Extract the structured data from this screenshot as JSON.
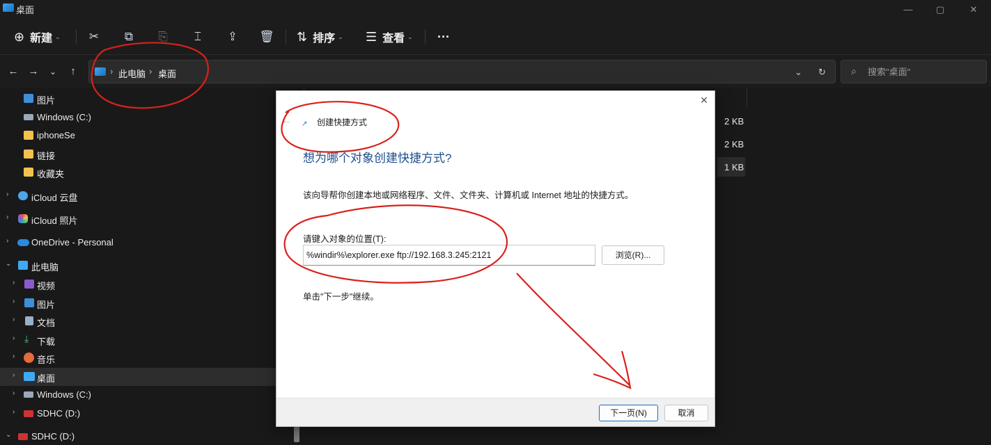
{
  "window": {
    "title": "桌面",
    "controls": {
      "minimize": "—",
      "maximize": "▢",
      "close": "✕"
    }
  },
  "toolbar": {
    "new_label": "新建",
    "sort_label": "排序",
    "view_label": "查看",
    "more_label": "···",
    "icons": [
      "cut-icon",
      "copy-icon",
      "paste-icon",
      "rename-icon",
      "share-icon",
      "delete-icon"
    ]
  },
  "nav": {
    "back": "←",
    "forward": "→",
    "recent": "⌄",
    "up": "↑"
  },
  "address": {
    "crumbs": [
      "此电脑",
      "桌面"
    ],
    "separator": "›",
    "dropdown": "⌄",
    "refresh": "↻"
  },
  "search": {
    "placeholder": "搜索\"桌面\""
  },
  "sidebar": {
    "items": [
      {
        "label": "图片",
        "icon": "pictures-icon",
        "color": "#3f8fd8"
      },
      {
        "label": "Windows (C:)",
        "icon": "drive-icon",
        "color": "#9aa9b8"
      },
      {
        "label": "iphoneSe",
        "icon": "folder-icon",
        "color": "#f2c24f"
      },
      {
        "label": "链接",
        "icon": "folder-icon",
        "color": "#f2c24f"
      },
      {
        "label": "收藏夹",
        "icon": "folder-icon",
        "color": "#f2c24f"
      },
      {
        "label": "iCloud 云盘",
        "icon": "icloud-drive-icon",
        "color": "#4ea6ea"
      },
      {
        "label": "iCloud 照片",
        "icon": "icloud-photos-icon",
        "color": "#e77"
      },
      {
        "label": "OneDrive - Personal",
        "icon": "onedrive-icon",
        "color": "#2a8ae0"
      },
      {
        "label": "此电脑",
        "icon": "this-pc-icon",
        "color": "#3fa9f5"
      },
      {
        "label": "视频",
        "icon": "videos-icon",
        "color": "#8a5bd0"
      },
      {
        "label": "图片",
        "icon": "pictures-icon",
        "color": "#3f8fd8"
      },
      {
        "label": "文档",
        "icon": "documents-icon",
        "color": "#9ab0c6"
      },
      {
        "label": "下载",
        "icon": "downloads-icon",
        "color": "#4ec27a"
      },
      {
        "label": "音乐",
        "icon": "music-icon",
        "color": "#e66a3c"
      },
      {
        "label": "桌面",
        "icon": "desktop-icon",
        "color": "#3fa9f5"
      },
      {
        "label": "Windows (C:)",
        "icon": "drive-icon",
        "color": "#9aa9b8"
      },
      {
        "label": "SDHC (D:)",
        "icon": "sd-card-icon",
        "color": "#c33"
      },
      {
        "label": "SDHC (D:)",
        "icon": "sd-card-icon",
        "color": "#c33"
      }
    ]
  },
  "content": {
    "sizes": [
      "2 KB",
      "2 KB",
      "1 KB"
    ]
  },
  "dialog": {
    "close": "✕",
    "back": "←",
    "wizard_icon": "↗",
    "wizard_title": "创建快捷方式",
    "heading": "想为哪个对象创建快捷方式?",
    "description": "该向导帮你创建本地或网络程序、文件、文件夹、计算机或 Internet 地址的快捷方式。",
    "field_label": "请键入对象的位置(T):",
    "location_value": "%windir%\\explorer.exe ftp://192.168.3.245:2121",
    "browse_label": "浏览(R)...",
    "hint": "单击\"下一步\"继续。",
    "next_label": "下一页(N)",
    "cancel_label": "取消"
  },
  "colors": {
    "background": "#191919",
    "accent": "#1a6fbf",
    "annotation": "#d9211c"
  }
}
